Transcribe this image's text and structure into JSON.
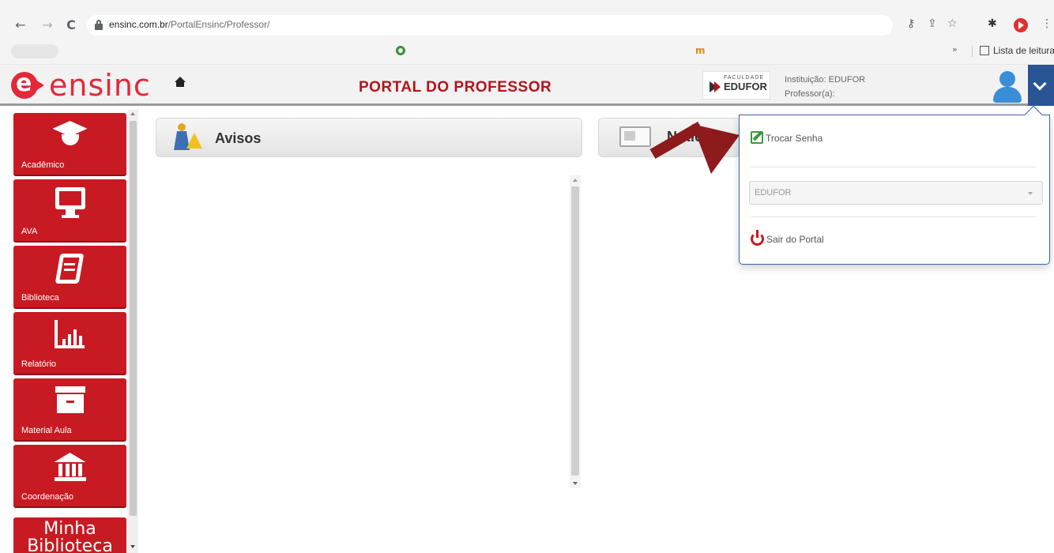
{
  "browser": {
    "url_domain": "ensinc.com.br",
    "url_path": "/PortalEnsinc/Professor/",
    "reading_list_label": "Lista de leitura",
    "overflow_symbol": "»",
    "nav_back": "←",
    "nav_forward": "→",
    "nav_reload": "C"
  },
  "header": {
    "logo_text": "ensinc",
    "portal_title": "PORTAL DO PROFESSOR",
    "institution_label": "Instituição: EDUFOR",
    "professor_label": "Professor(a):",
    "partner_logo_small": "FACULDADE",
    "partner_logo_big": "EDUFOR"
  },
  "sidebar": {
    "items": [
      {
        "label": "Acadêmico",
        "icon": "graduation-cap-icon"
      },
      {
        "label": "AVA",
        "icon": "monitor-icon"
      },
      {
        "label": "Biblioteca",
        "icon": "book-icon"
      },
      {
        "label": "Relatório",
        "icon": "bar-chart-icon"
      },
      {
        "label": "Material Aula",
        "icon": "archive-box-icon"
      },
      {
        "label": "Coordenação",
        "icon": "institution-icon"
      }
    ],
    "extra_tile": "Minha Biblioteca"
  },
  "main": {
    "avisos_title": "Avisos",
    "noticias_title": "Notícias"
  },
  "user_menu": {
    "change_password": "Trocar Senha",
    "institution_select_value": "EDUFOR",
    "logout": "Sair do Portal"
  },
  "colors": {
    "brand_red": "#c81a22",
    "header_blue": "#2a5595",
    "annotation_arrow": "#8e1b1b"
  }
}
